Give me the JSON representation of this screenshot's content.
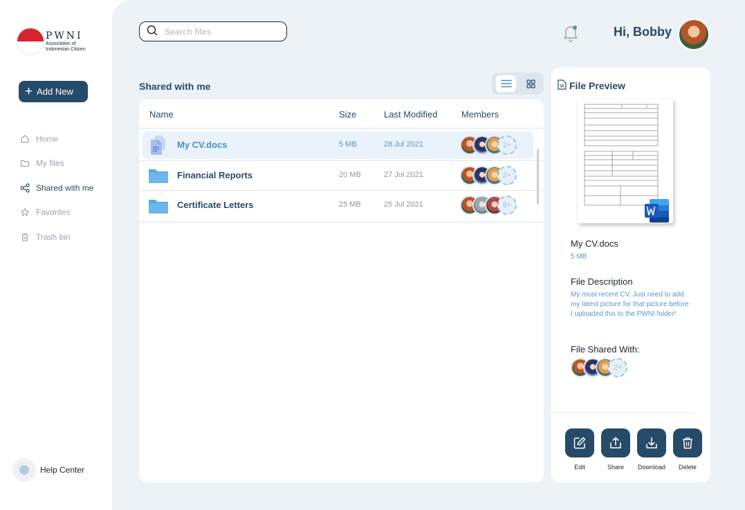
{
  "brand": {
    "name": "PWNI",
    "subtitle_line1": "Association of",
    "subtitle_line2": "Indonesian Citizen",
    "logo_colors": [
      "#d9232f",
      "#ffffff"
    ]
  },
  "sidebar": {
    "add_new_label": "Add New",
    "items": [
      {
        "label": "Home",
        "icon": "home-icon",
        "active": false
      },
      {
        "label": "My files",
        "icon": "folder-icon",
        "active": false
      },
      {
        "label": "Shared with me",
        "icon": "share-icon",
        "active": true
      },
      {
        "label": "Favorites",
        "icon": "star-icon",
        "active": false
      },
      {
        "label": "Trash bin",
        "icon": "trash-icon",
        "active": false
      }
    ],
    "help_label": "Help Center"
  },
  "header": {
    "search_placeholder": "Search files",
    "greeting": "Hi, Bobby"
  },
  "main": {
    "section_title": "Shared with me",
    "columns": [
      "Name",
      "Size",
      "Last Modified",
      "Members"
    ],
    "files": [
      {
        "name": "My CV.docs",
        "size": "5 MB",
        "modified": "28 Jul 2021",
        "more": "2+",
        "selected": true,
        "icon": "document-icon"
      },
      {
        "name": "Financial Reports",
        "size": "20 MB",
        "modified": "27 Jul 2021",
        "more": "2+",
        "selected": false,
        "icon": "folder-icon"
      },
      {
        "name": "Certificate Letters",
        "size": "25 MB",
        "modified": "25 Jul 2021",
        "more": "8+",
        "selected": false,
        "icon": "folder-icon"
      }
    ]
  },
  "preview": {
    "title": "File Preview",
    "file_name": "My CV.docs",
    "file_size": "5 MB",
    "description_heading": "File Description",
    "description": "My most recent CV. Just need to add my latest picture for that picture before I uploaded this to the PWNI folder!",
    "shared_heading": "File Shared With:",
    "shared_more": "2+",
    "actions": [
      "Edit",
      "Share",
      "Download",
      "Delete"
    ]
  },
  "colors": {
    "primary": "#264b68",
    "accent": "#4a8ec5",
    "background": "#edf2f6"
  }
}
